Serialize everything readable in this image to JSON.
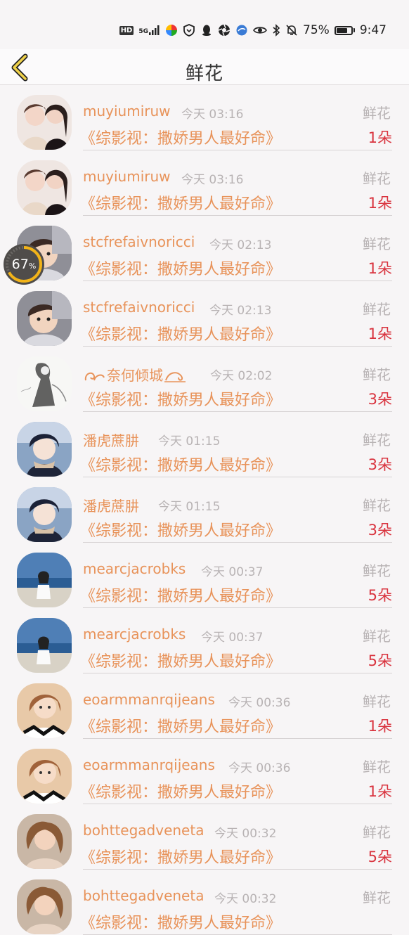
{
  "status_bar": {
    "hd": "HD",
    "network": "5G",
    "battery_percent": "75%",
    "battery_level": 0.75,
    "time": "9:47"
  },
  "header": {
    "title": "鲜花"
  },
  "floating_progress": {
    "value": "67",
    "unit": "%",
    "fraction": 0.67
  },
  "rows": [
    {
      "name": "muyiumiruw",
      "time": "今天 03:16",
      "gift": "鲜花",
      "book": "《综影视：撒娇男人最好命》",
      "count": "1朵",
      "avatar": "two-girls"
    },
    {
      "name": "muyiumiruw",
      "time": "今天 03:16",
      "gift": "鲜花",
      "book": "《综影视：撒娇男人最好命》",
      "count": "1朵",
      "avatar": "two-girls"
    },
    {
      "name": "stcfrefaivnoricci",
      "time": "今天 02:13",
      "gift": "鲜花",
      "book": "《综影视：撒娇男人最好命》",
      "count": "1朵",
      "avatar": "child"
    },
    {
      "name": "stcfrefaivnoricci",
      "time": "今天 02:13",
      "gift": "鲜花",
      "book": "《综影视：撒娇男人最好命》",
      "count": "1朵",
      "avatar": "child"
    },
    {
      "name": "奈何倾城",
      "time": "今天 02:02",
      "gift": "鲜花",
      "book": "《综影视：撒娇男人最好命》",
      "count": "3朵",
      "avatar": "ink-figure",
      "decorated": true
    },
    {
      "name": "潘虎蔗肼",
      "time": "今天 01:15",
      "gift": "鲜花",
      "book": "《综影视：撒娇男人最好命》",
      "count": "3朵",
      "avatar": "anime-boy"
    },
    {
      "name": "潘虎蔗肼",
      "time": "今天 01:15",
      "gift": "鲜花",
      "book": "《综影视：撒娇男人最好命》",
      "count": "3朵",
      "avatar": "anime-boy"
    },
    {
      "name": "mearcjacrobks",
      "time": "今天 00:37",
      "gift": "鲜花",
      "book": "《综影视：撒娇男人最好命》",
      "count": "5朵",
      "avatar": "beach-girl"
    },
    {
      "name": "mearcjacrobks",
      "time": "今天 00:37",
      "gift": "鲜花",
      "book": "《综影视：撒娇男人最好命》",
      "count": "5朵",
      "avatar": "beach-girl"
    },
    {
      "name": "eoarmmanrqijeans",
      "time": "今天 00:36",
      "gift": "鲜花",
      "book": "《综影视：撒娇男人最好命》",
      "count": "1朵",
      "avatar": "selfie-girl"
    },
    {
      "name": "eoarmmanrqijeans",
      "time": "今天 00:36",
      "gift": "鲜花",
      "book": "《综影视：撒娇男人最好命》",
      "count": "1朵",
      "avatar": "selfie-girl"
    },
    {
      "name": "bohttegadveneta",
      "time": "今天 00:32",
      "gift": "鲜花",
      "book": "《综影视：撒娇男人最好命》",
      "count": "5朵",
      "avatar": "curly-girl"
    },
    {
      "name": "bohttegadveneta",
      "time": "今天 00:32",
      "gift": "鲜花",
      "book": "《综影视：撒娇男人最好命》",
      "count": "",
      "avatar": "curly-girl"
    }
  ]
}
